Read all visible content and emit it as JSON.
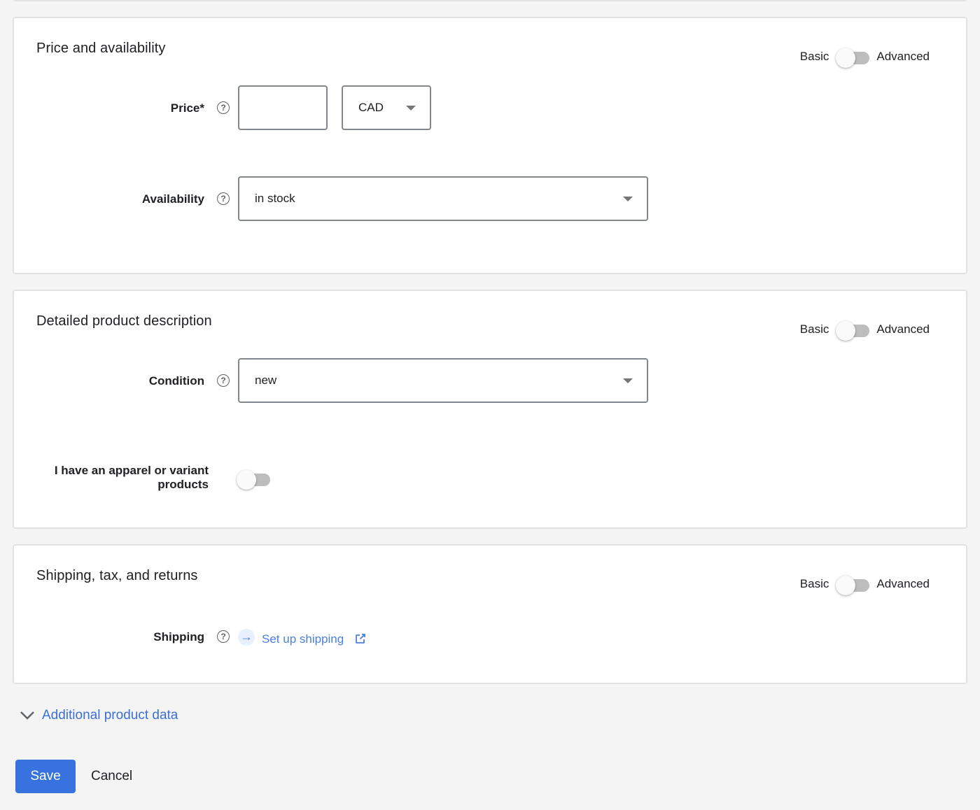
{
  "mode_switch": {
    "basic_label": "Basic",
    "advanced_label": "Advanced"
  },
  "sections": {
    "price": {
      "title": "Price and availability",
      "mode_advanced": false,
      "price_label": "Price*",
      "price_value": "",
      "currency": "CAD",
      "availability_label": "Availability",
      "availability_value": "in stock"
    },
    "description": {
      "title": "Detailed product description",
      "mode_advanced": false,
      "condition_label": "Condition",
      "condition_value": "new",
      "apparel_label_line1": "I have an apparel or variant",
      "apparel_label_line2": "products",
      "apparel_enabled": false
    },
    "shipping": {
      "title": "Shipping, tax, and returns",
      "mode_advanced": false,
      "shipping_label": "Shipping",
      "setup_link": "Set up shipping"
    }
  },
  "icons": {
    "help": "?",
    "arrow": "→",
    "chevron": "chevron-down",
    "external": "open-in-new"
  },
  "additional_data_label": "Additional product data",
  "actions": {
    "save_label": "Save",
    "cancel_label": "Cancel"
  },
  "colors": {
    "primary": "#3872de",
    "link": "#4a7fe0",
    "page_bg": "#f4f4f4"
  }
}
